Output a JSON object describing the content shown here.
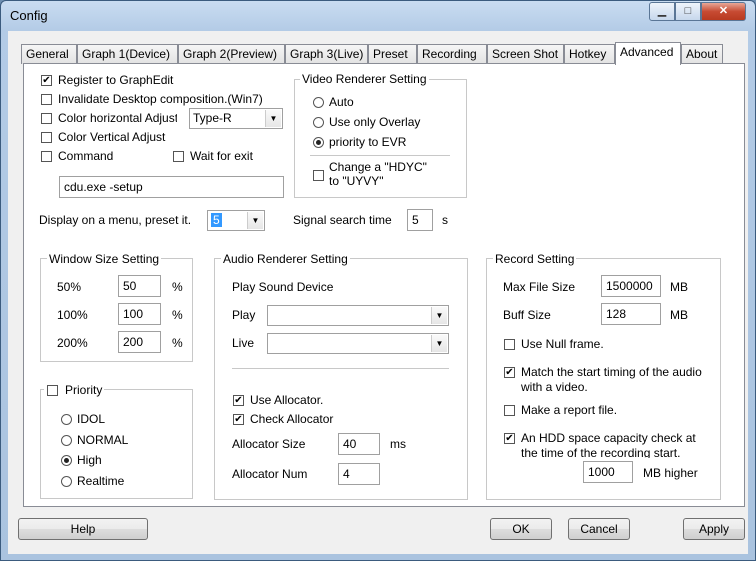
{
  "window": {
    "title": "Config"
  },
  "tabs": [
    "General",
    "Graph 1(Device)",
    "Graph 2(Preview)",
    "Graph 3(Live)",
    "Preset",
    "Recording",
    "Screen Shot",
    "Hotkey",
    "Advanced",
    "About"
  ],
  "general": {
    "register_graphedit": "Register to GraphEdit",
    "invalidate_desktop": "Invalidate Desktop composition.(Win7)",
    "color_horizontal": "Color horizontal Adjust",
    "color_type": "Type-R",
    "color_vertical": "Color Vertical Adjust",
    "command": "Command",
    "wait_for_exit": "Wait for exit",
    "command_value": "cdu.exe -setup",
    "display_menu_label": "Display on a menu, preset it.",
    "display_menu_value": "5",
    "signal_search_label": "Signal search time",
    "signal_search_value": "5",
    "signal_search_unit": "s"
  },
  "video_renderer": {
    "title": "Video Renderer Setting",
    "auto": "Auto",
    "overlay": "Use only Overlay",
    "evr": "priority to EVR",
    "change_hdyc_1": "Change a \"HDYC\"",
    "change_hdyc_2": "to \"UYVY\""
  },
  "window_size": {
    "title": "Window Size Setting",
    "rows": [
      {
        "label": "50%",
        "value": "50",
        "unit": "%"
      },
      {
        "label": "100%",
        "value": "100",
        "unit": "%"
      },
      {
        "label": "200%",
        "value": "200",
        "unit": "%"
      }
    ]
  },
  "priority": {
    "title": "Priority",
    "options": [
      "IDOL",
      "NORMAL",
      "High",
      "Realtime"
    ]
  },
  "audio": {
    "title": "Audio Renderer Setting",
    "play_sound_device": "Play Sound Device",
    "play": "Play",
    "live": "Live",
    "use_allocator": "Use Allocator.",
    "check_allocator": "Check Allocator",
    "allocator_size": "Allocator Size",
    "allocator_size_value": "40",
    "allocator_size_unit": "ms",
    "allocator_num": "Allocator Num",
    "allocator_num_value": "4"
  },
  "record": {
    "title": "Record Setting",
    "max_file_size": "Max File Size",
    "max_file_size_value": "1500000",
    "max_file_size_unit": "MB",
    "buff_size": "Buff Size",
    "buff_size_value": "128",
    "buff_size_unit": "MB",
    "use_null_frame": "Use Null frame.",
    "match_timing_1": "Match the start timing of the audio",
    "match_timing_2": "with a video.",
    "make_report": "Make a report file.",
    "hdd_check_1": "An HDD space capacity check at",
    "hdd_check_2": "the time of the recording start.",
    "hdd_value": "1000",
    "hdd_unit": "MB higher"
  },
  "buttons": {
    "help": "Help",
    "ok": "OK",
    "cancel": "Cancel",
    "apply": "Apply"
  }
}
